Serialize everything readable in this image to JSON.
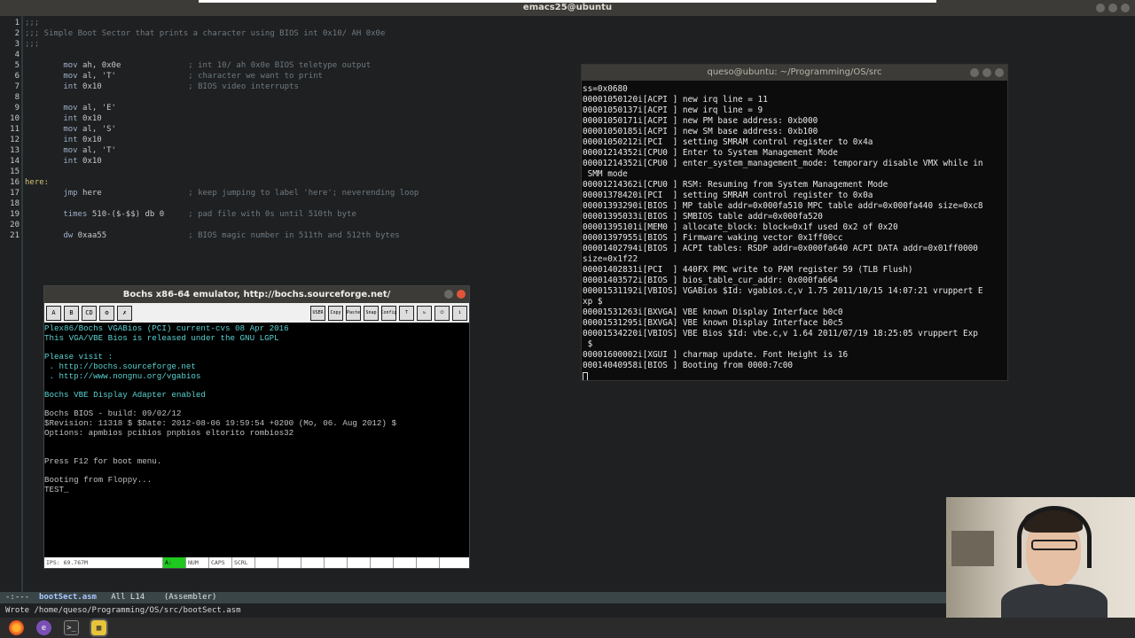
{
  "emacs": {
    "title": "emacs25@ubuntu",
    "lines": [
      {
        "n": "1",
        "parts": [
          {
            "c": "cm",
            "t": ";;;"
          }
        ]
      },
      {
        "n": "2",
        "parts": [
          {
            "c": "cm",
            "t": ";;; Simple Boot Sector that prints a character using BIOS int 0x10/ AH 0x0e"
          }
        ]
      },
      {
        "n": "3",
        "parts": [
          {
            "c": "cm",
            "t": ";;;"
          }
        ]
      },
      {
        "n": "4",
        "parts": []
      },
      {
        "n": "5",
        "parts": [
          {
            "c": "kw",
            "t": "        mov "
          },
          {
            "c": "txt",
            "t": "ah, 0x0e"
          },
          {
            "c": "cm",
            "t": "              ; int 10/ ah 0x0e BIOS teletype output"
          }
        ]
      },
      {
        "n": "6",
        "parts": [
          {
            "c": "kw",
            "t": "        mov "
          },
          {
            "c": "txt",
            "t": "al, 'T'"
          },
          {
            "c": "cm",
            "t": "               ; character we want to print"
          }
        ]
      },
      {
        "n": "7",
        "parts": [
          {
            "c": "kw",
            "t": "        int "
          },
          {
            "c": "txt",
            "t": "0x10"
          },
          {
            "c": "cm",
            "t": "                  ; BIOS video interrupts"
          }
        ]
      },
      {
        "n": "8",
        "parts": []
      },
      {
        "n": "9",
        "parts": [
          {
            "c": "kw",
            "t": "        mov "
          },
          {
            "c": "txt",
            "t": "al, 'E'"
          }
        ]
      },
      {
        "n": "10",
        "parts": [
          {
            "c": "kw",
            "t": "        int "
          },
          {
            "c": "txt",
            "t": "0x10"
          }
        ]
      },
      {
        "n": "11",
        "parts": [
          {
            "c": "kw",
            "t": "        mov "
          },
          {
            "c": "txt",
            "t": "al, 'S'"
          }
        ]
      },
      {
        "n": "12",
        "parts": [
          {
            "c": "kw",
            "t": "        int "
          },
          {
            "c": "txt",
            "t": "0x10"
          }
        ]
      },
      {
        "n": "13",
        "parts": [
          {
            "c": "kw",
            "t": "        mov "
          },
          {
            "c": "txt",
            "t": "al, 'T'"
          }
        ]
      },
      {
        "n": "14",
        "parts": [
          {
            "c": "kw",
            "t": "        int "
          },
          {
            "c": "txt",
            "t": "0x10"
          }
        ]
      },
      {
        "n": "15",
        "parts": []
      },
      {
        "n": "16",
        "parts": [
          {
            "c": "lbl",
            "t": "here:"
          }
        ]
      },
      {
        "n": "17",
        "parts": [
          {
            "c": "kw",
            "t": "        jmp "
          },
          {
            "c": "txt",
            "t": "here"
          },
          {
            "c": "cm",
            "t": "                  ; keep jumping to label 'here'; neverending loop"
          }
        ]
      },
      {
        "n": "18",
        "parts": []
      },
      {
        "n": "19",
        "parts": [
          {
            "c": "kw",
            "t": "        times "
          },
          {
            "c": "txt",
            "t": "510-($-$$) db 0"
          },
          {
            "c": "cm",
            "t": "     ; pad file with 0s until 510th byte"
          }
        ]
      },
      {
        "n": "20",
        "parts": []
      },
      {
        "n": "21",
        "parts": [
          {
            "c": "kw",
            "t": "        dw "
          },
          {
            "c": "txt",
            "t": "0xaa55"
          },
          {
            "c": "cm",
            "t": "                 ; BIOS magic number in 511th and 512th bytes"
          }
        ]
      }
    ],
    "modeline": {
      "prefix": "-:---  ",
      "buffer": "bootSect.asm",
      "rest": "   All L14    (Assembler)"
    },
    "echo": "Wrote /home/queso/Programming/OS/src/bootSect.asm"
  },
  "terminal": {
    "title": "queso@ubuntu: ~/Programming/OS/src",
    "lines": [
      "ss=0x0680",
      "00001050120i[ACPI ] new irq line = 11",
      "00001050137i[ACPI ] new irq line = 9",
      "00001050171i[ACPI ] new PM base address: 0xb000",
      "00001050185i[ACPI ] new SM base address: 0xb100",
      "00001050212i[PCI  ] setting SMRAM control register to 0x4a",
      "00001214352i[CPU0 ] Enter to System Management Mode",
      "00001214352i[CPU0 ] enter_system_management_mode: temporary disable VMX while in",
      " SMM mode",
      "00001214362i[CPU0 ] RSM: Resuming from System Management Mode",
      "00001378420i[PCI  ] setting SMRAM control register to 0x0a",
      "00001393290i[BIOS ] MP table addr=0x000fa510 MPC table addr=0x000fa440 size=0xc8",
      "00001395033i[BIOS ] SMBIOS table addr=0x000fa520",
      "00001395101i[MEM0 ] allocate_block: block=0x1f used 0x2 of 0x20",
      "00001397955i[BIOS ] Firmware waking vector 0x1ff00cc",
      "00001402794i[BIOS ] ACPI tables: RSDP addr=0x000fa640 ACPI DATA addr=0x01ff0000",
      "size=0x1f22",
      "00001402831i[PCI  ] 440FX PMC write to PAM register 59 (TLB Flush)",
      "00001403572i[BIOS ] bios_table_cur_addr: 0x000fa664",
      "00001531192i[VBIOS] VGABios $Id: vgabios.c,v 1.75 2011/10/15 14:07:21 vruppert E",
      "xp $",
      "00001531263i[BXVGA] VBE known Display Interface b0c0",
      "00001531295i[BXVGA] VBE known Display Interface b0c5",
      "00001534220i[VBIOS] VBE Bios $Id: vbe.c,v 1.64 2011/07/19 18:25:05 vruppert Exp",
      " $",
      "00001600002i[XGUI ] charmap update. Font Height is 16",
      "00014040958i[BIOS ] Booting from 0000:7c00"
    ]
  },
  "bochs": {
    "title": "Bochs x86-64 emulator, http://bochs.sourceforge.net/",
    "toolbar_left": [
      "A",
      "B",
      "CD",
      "⚙",
      "✗"
    ],
    "toolbar_right": [
      "USER",
      "Copy",
      "Paste",
      "Snap",
      "Config",
      "T",
      "↻",
      "⏻",
      "i"
    ],
    "screen": [
      {
        "c": "cy",
        "t": "Plex86/Bochs VGABios (PCI) current-cvs 08 Apr 2016"
      },
      {
        "c": "cy",
        "t": "This VGA/VBE Bios is released under the GNU LGPL"
      },
      {
        "c": "",
        "t": ""
      },
      {
        "c": "cy",
        "t": "Please visit :"
      },
      {
        "c": "cy",
        "t": " . http://bochs.sourceforge.net"
      },
      {
        "c": "cy",
        "t": " . http://www.nongnu.org/vgabios"
      },
      {
        "c": "",
        "t": ""
      },
      {
        "c": "cy",
        "t": "Bochs VBE Display Adapter enabled"
      },
      {
        "c": "",
        "t": ""
      },
      {
        "c": "",
        "t": "Bochs BIOS - build: 09/02/12"
      },
      {
        "c": "",
        "t": "$Revision: 11318 $ $Date: 2012-08-06 19:59:54 +0200 (Mo, 06. Aug 2012) $"
      },
      {
        "c": "",
        "t": "Options: apmbios pcibios pnpbios eltorito rombios32"
      },
      {
        "c": "",
        "t": ""
      },
      {
        "c": "",
        "t": ""
      },
      {
        "c": "",
        "t": "Press F12 for boot menu."
      },
      {
        "c": "",
        "t": ""
      },
      {
        "c": "",
        "t": "Booting from Floppy..."
      },
      {
        "c": "",
        "t": "TEST_"
      }
    ],
    "status": [
      "IPS: 69.767M",
      "A:",
      "NUM",
      "CAPS",
      "SCRL",
      "",
      "",
      "",
      "",
      "",
      "",
      "",
      ""
    ]
  },
  "taskbar": {
    "items": [
      {
        "name": "firefox-icon",
        "glyph": ""
      },
      {
        "name": "emacs-icon",
        "glyph": "e"
      },
      {
        "name": "terminal-icon",
        "glyph": ">_"
      },
      {
        "name": "bochs-icon",
        "glyph": "▦"
      }
    ]
  }
}
